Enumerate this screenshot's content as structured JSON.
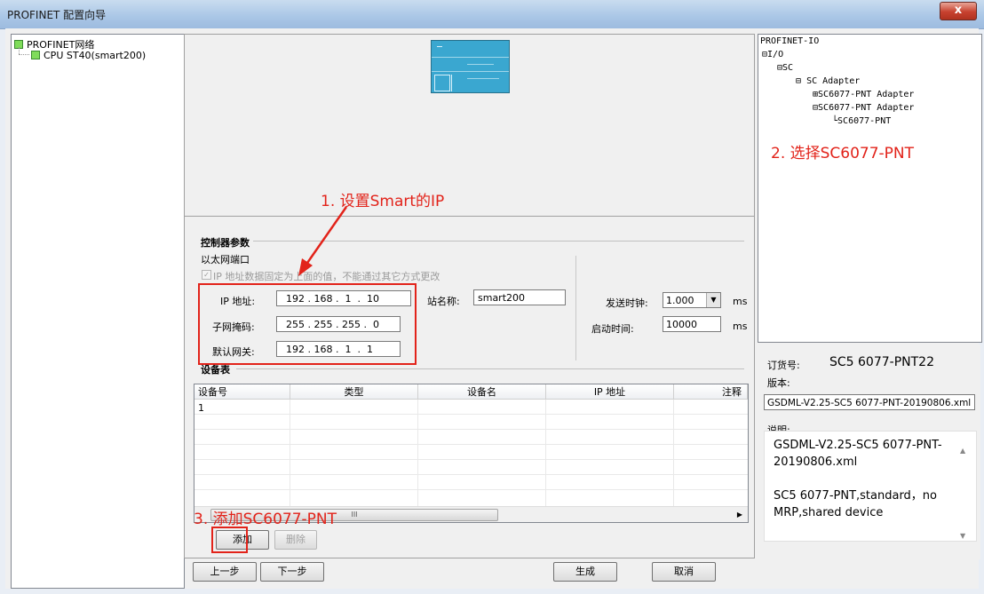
{
  "window": {
    "title": "PROFINET 配置向导",
    "close_symbol": "x"
  },
  "left_tree": {
    "root": "PROFINET网络",
    "child": "CPU ST40(smart200)"
  },
  "controller": {
    "section_title": "控制器参数",
    "port_label": "以太网端口",
    "fixed_ip_note": "IP 地址数据固定为上面的值，不能通过其它方式更改",
    "ip_label": "IP 地址:",
    "ip_parts": [
      "192",
      "168",
      "1",
      "10"
    ],
    "subnet_label": "子网掩码:",
    "subnet_parts": [
      "255",
      "255",
      "255",
      "0"
    ],
    "gateway_label": "默认网关:",
    "gateway_parts": [
      "192",
      "168",
      "1",
      "1"
    ],
    "station_label": "站名称:",
    "station_value": "smart200",
    "send_clock_label": "发送时钟:",
    "send_clock_value": "1.000",
    "send_clock_unit": "ms",
    "startup_label": "启动时间:",
    "startup_value": "10000",
    "startup_unit": "ms"
  },
  "device_table": {
    "title": "设备表",
    "columns": [
      "设备号",
      "类型",
      "设备名",
      "IP 地址",
      "注释"
    ],
    "rows": [
      [
        "1",
        "",
        "",
        "",
        ""
      ]
    ],
    "scroll_mark": "III"
  },
  "buttons": {
    "add": "添加",
    "delete": "删除",
    "prev": "上一步",
    "next": "下一步",
    "generate": "生成",
    "cancel": "取消"
  },
  "right_tree": {
    "root": "PROFINET-IO",
    "io": "I/O",
    "sc": "SC",
    "adapter": "SC Adapter",
    "pnt_adapter_1": "SC6077-PNT Adapter",
    "pnt_adapter_2": "SC6077-PNT Adapter",
    "pnt": "SC6077-PNT"
  },
  "info": {
    "order_label": "订货号:",
    "order_value": "SC5 6077-PNT22",
    "version_label": "版本:",
    "gsdml": "GSDML-V2.25-SC5 6077-PNT-20190806.xml",
    "desc_label": "说明:",
    "desc_line1": "GSDML-V2.25-SC5 6077-PNT-",
    "desc_line2": "20190806.xml",
    "desc_line3": "SC5 6077-PNT,standard，no",
    "desc_line4": "MRP,shared device"
  },
  "annotations": {
    "step1": "1. 设置Smart的IP",
    "step2": "2. 选择SC6077-PNT",
    "step3": "3. 添加SC6077-PNT"
  },
  "colors": {
    "annotation": "#e2231a",
    "device_image": "#3aa7d0"
  }
}
